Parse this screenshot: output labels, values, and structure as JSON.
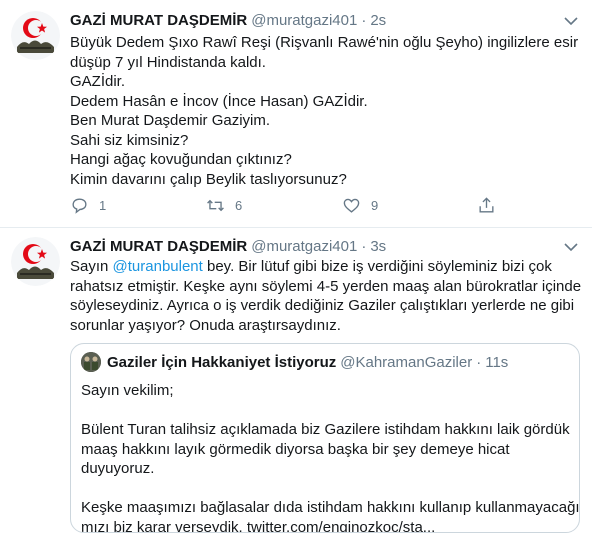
{
  "tweets": [
    {
      "author_name": "GAZİ MURAT DAŞDEMİR",
      "handle": "@muratgazi401",
      "dot": "·",
      "time": "2s",
      "lines": [
        "Büyük Dedem Şıxo Rawî Reşi (Rişvanlı Rawé'nin oğlu Şeyho) ingilizlere esir",
        "düşüp 7 yıl Hindistanda kaldı.",
        "GAZİdir.",
        "Dedem Hasân e İncov (İnce Hasan) GAZİdir.",
        "Ben Murat Daşdemir Gaziyim.",
        "Sahi siz kimsiniz?",
        "Hangi ağaç kovuğundan çıktınız?",
        "Kimin davarını çalıp Beylik taslıyorsunuz?"
      ],
      "actions": {
        "reply_count": "1",
        "retweet_count": "6",
        "like_count": "9"
      }
    },
    {
      "author_name": "GAZİ MURAT DAŞDEMİR",
      "handle": "@muratgazi401",
      "dot": "·",
      "time": "3s",
      "line1_prefix": "Sayın ",
      "line1_mention": "@turanbulent",
      "line1_suffix": " bey. Bir lütuf gibi bize iş verdiğini söyleminiz bizi çok",
      "lines": [
        "rahatsız etmiştir. Keşke  aynı söylemi 4-5 yerden maaş alan bürokratlar içinde",
        "söyleseydiniz. Ayrıca o iş verdik dediğiniz Gaziler çalıştıkları yerlerde ne gibi",
        "sorunlar yaşıyor? Onuda araştırsaydınız."
      ],
      "quote": {
        "author_name": "Gaziler İçin Hakkaniyet İstiyoruz",
        "handle": "@KahramanGaziler",
        "dot": "·",
        "time": "11s",
        "para1": [
          "Sayın vekilim;"
        ],
        "para2": [
          "Bülent Turan talihsiz açıklamada  biz Gazilere istihdam hakkını laik gördük",
          "maaş hakkını layık görmedik diyorsa başka bir şey demeye hicat",
          "duyuyoruz."
        ],
        "para3": [
          "Keşke maaşımızı bağlasalar dıda istihdam hakkını kullanıp kullanmayacağı",
          "mızı biz karar verseydik. twitter.com/enginozkoc/sta..."
        ]
      }
    }
  ],
  "colors": {
    "text": "#14171a",
    "secondary": "#657786",
    "link": "#1b95e0",
    "border": "#e6ecf0",
    "flag_red": "#e30a17"
  },
  "icons": [
    "flag-avatar",
    "caret-down-icon",
    "reply-icon",
    "retweet-icon",
    "like-icon",
    "share-icon"
  ]
}
